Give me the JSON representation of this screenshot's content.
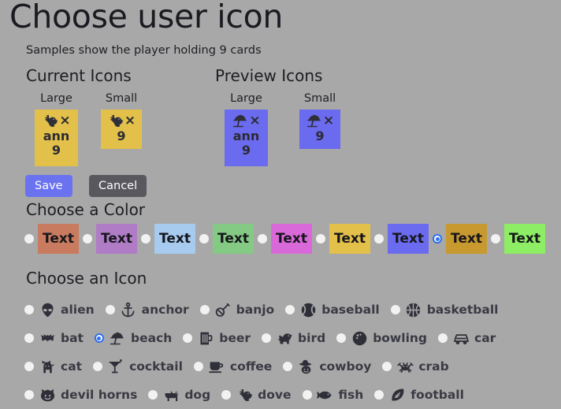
{
  "title": "Choose user icon",
  "subtitle": "Samples show the player holding 9 cards",
  "sections": {
    "current_icons": "Current Icons",
    "preview_icons": "Preview Icons",
    "choose_color": "Choose a Color",
    "choose_icon": "Choose an Icon"
  },
  "samples": {
    "large_label": "Large",
    "small_label": "Small",
    "x_mark": "×",
    "player_name": "ann",
    "card_count": "9",
    "current": {
      "icon": "dove-icon",
      "color": "#e3c04a"
    },
    "preview": {
      "icon": "beach-icon",
      "color": "#6b6bef"
    }
  },
  "buttons": {
    "save": "Save",
    "cancel": "Cancel",
    "save_color": "#6b72ef",
    "cancel_color": "#58585e"
  },
  "colors": {
    "swatch_text": "Text",
    "selected_index": 7,
    "items": [
      {
        "name": "terracotta",
        "hex": "#c87b5e"
      },
      {
        "name": "orchid",
        "hex": "#b07cc6"
      },
      {
        "name": "light-blue",
        "hex": "#a6cbef"
      },
      {
        "name": "green",
        "hex": "#84c984"
      },
      {
        "name": "magenta",
        "hex": "#d968d9"
      },
      {
        "name": "gold",
        "hex": "#e3c04a"
      },
      {
        "name": "blue-violet",
        "hex": "#6b6bef"
      },
      {
        "name": "dark-gold",
        "hex": "#c8992e"
      },
      {
        "name": "lime",
        "hex": "#8ded64"
      }
    ]
  },
  "icons": {
    "selected": "beach",
    "rows": [
      [
        {
          "id": "alien",
          "label": "alien"
        },
        {
          "id": "anchor",
          "label": "anchor"
        },
        {
          "id": "banjo",
          "label": "banjo"
        },
        {
          "id": "baseball",
          "label": "baseball"
        },
        {
          "id": "basketball",
          "label": "basketball"
        }
      ],
      [
        {
          "id": "bat",
          "label": "bat"
        },
        {
          "id": "beach",
          "label": "beach"
        },
        {
          "id": "beer",
          "label": "beer"
        },
        {
          "id": "bird",
          "label": "bird"
        },
        {
          "id": "bowling",
          "label": "bowling"
        },
        {
          "id": "car",
          "label": "car"
        }
      ],
      [
        {
          "id": "cat",
          "label": "cat"
        },
        {
          "id": "cocktail",
          "label": "cocktail"
        },
        {
          "id": "coffee",
          "label": "coffee"
        },
        {
          "id": "cowboy",
          "label": "cowboy"
        },
        {
          "id": "crab",
          "label": "crab"
        }
      ],
      [
        {
          "id": "devil-horns",
          "label": "devil horns"
        },
        {
          "id": "dog",
          "label": "dog"
        },
        {
          "id": "dove",
          "label": "dove"
        },
        {
          "id": "fish",
          "label": "fish"
        },
        {
          "id": "football",
          "label": "football"
        }
      ]
    ]
  }
}
